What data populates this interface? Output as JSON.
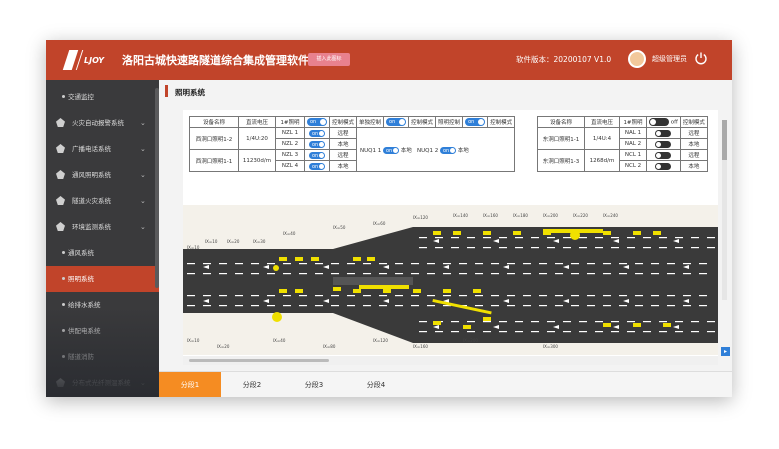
{
  "header": {
    "logo_text": "LJOY",
    "title": "洛阳古城快速路隧道综合集成管理软件",
    "badge": "插入此图标",
    "version": "软件版本：20200107 V1.0",
    "username": "超级管理员"
  },
  "sidebar": {
    "items": [
      {
        "label": "交通监控",
        "icon": false,
        "active": false
      },
      {
        "label": "火灾自动报警系统",
        "icon": true,
        "active": false
      },
      {
        "label": "广播电话系统",
        "icon": true,
        "active": false
      },
      {
        "label": "通风照明系统",
        "icon": true,
        "active": false
      },
      {
        "label": "隧道火灾系统",
        "icon": true,
        "active": false
      },
      {
        "label": "环境监测系统",
        "icon": true,
        "active": false
      },
      {
        "label": "通风系统",
        "icon": false,
        "active": false
      },
      {
        "label": "照明系统",
        "icon": false,
        "active": true
      },
      {
        "label": "给排水系统",
        "icon": false,
        "active": false
      },
      {
        "label": "供配电系统",
        "icon": false,
        "active": false
      },
      {
        "label": "隧道消防",
        "icon": false,
        "active": false
      },
      {
        "label": "分布式光纤测温系统",
        "icon": true,
        "active": false
      }
    ]
  },
  "main": {
    "section_title": "照明系统"
  },
  "control_table_left": {
    "headers": [
      "设备名称",
      "直流电压",
      "1#照明",
      "控制模式",
      "单独控制",
      "控制模式",
      "照明控制",
      "控制模式"
    ],
    "toggle_on": "on",
    "toggle_off": "off",
    "rows": [
      {
        "name": "西洞口照明1-2",
        "voltage": "1/4U:20",
        "circuits": [
          {
            "id": "NZL 1",
            "mode": "远程"
          },
          {
            "id": "NZL 2",
            "mode": "本地"
          }
        ]
      },
      {
        "name": "西洞口照明1-1",
        "voltage": "11230d/m",
        "circuits": [
          {
            "id": "NZL 3",
            "mode": "远程"
          },
          {
            "id": "NZL 4",
            "mode": "本地"
          }
        ]
      }
    ],
    "group_a": {
      "label": "NUQ1 1",
      "mode": "本地"
    },
    "group_b": {
      "label": "NUQ1 2",
      "mode": "本地"
    }
  },
  "control_table_right": {
    "headers": [
      "设备名称",
      "直流电压",
      "1#照明",
      "控制模式"
    ],
    "rows": [
      {
        "name": "东洞口照明1-1",
        "voltage": "1/4U:4",
        "circuits": [
          {
            "id": "NAL 1",
            "mode": "远程"
          },
          {
            "id": "NAL 2",
            "mode": "本地"
          }
        ]
      },
      {
        "name": "东洞口照明1-3",
        "voltage": "1268d/m",
        "circuits": [
          {
            "id": "NCL 1",
            "mode": "远程"
          },
          {
            "id": "NCL 2",
            "mode": "本地"
          }
        ]
      }
    ]
  },
  "tunnel_labels": {
    "top": [
      "IX=10",
      "IX=10",
      "IX=20",
      "IX=30",
      "IX=40",
      "IX=50",
      "IX=60",
      "IX=120",
      "IX=140",
      "IX=160",
      "IX=180",
      "IX=200",
      "IX=220",
      "IX=240"
    ],
    "bottom": [
      "IX=10",
      "IX=20",
      "IX=40",
      "IX=80",
      "IX=120",
      "IX=160",
      "IX=200",
      "IX=300"
    ]
  },
  "tabs": [
    "分段1",
    "分段2",
    "分段3",
    "分段4"
  ],
  "colors": {
    "brand": "#c1442a",
    "sidebar_bg": "#3a3a3c",
    "tab_active": "#f58c22",
    "toggle_on": "#2f7fd8",
    "lamp": "#f0e000",
    "road": "#3a3a3a"
  }
}
